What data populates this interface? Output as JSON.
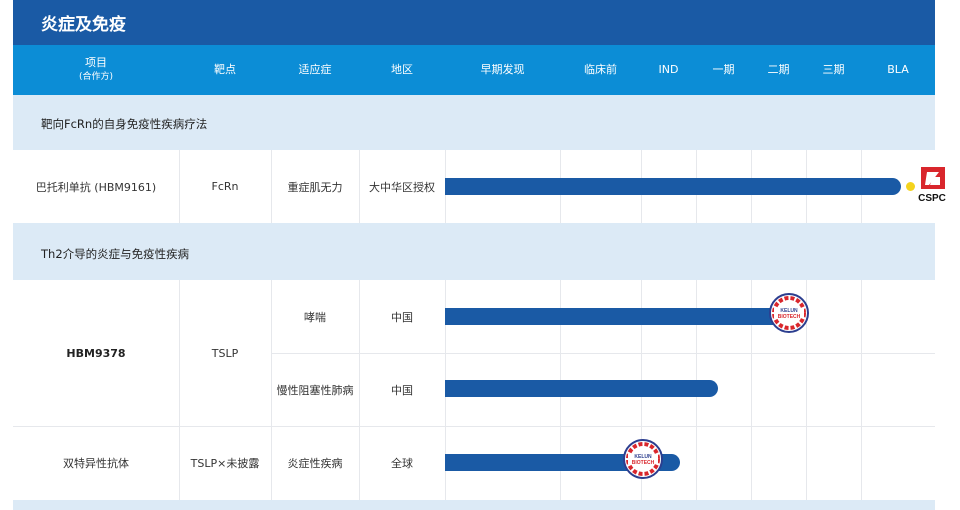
{
  "title": "炎症及免疫",
  "header": {
    "project": "项目",
    "partner": "(合作方)",
    "target": "靶点",
    "indication": "适应症",
    "region": "地区",
    "stages": [
      "早期发现",
      "临床前",
      "IND",
      "一期",
      "二期",
      "三期",
      "BLA"
    ]
  },
  "sections": [
    {
      "label": "靶向FcRn的自身免疫性疾病疗法"
    },
    {
      "label": "Th2介导的炎症与免疫性疾病"
    }
  ],
  "rows": [
    {
      "project": "巴托利单抗 (HBM9161)",
      "target": "FcRn",
      "indication": "重症肌无力",
      "region": "大中华区授权",
      "partner_logo": "cspc-logo",
      "partner_logo_text": "CSPC"
    },
    {
      "project": "HBM9378",
      "target": "TSLP",
      "indication": "哮喘",
      "region": "中国",
      "partner_logo": "hutchmed-logo",
      "partner_logo_text": "KELUN BIOTECH"
    },
    {
      "indication": "慢性阻塞性肺病",
      "region": "中国"
    },
    {
      "project": "双特异性抗体",
      "target": "TSLP×未披露",
      "indication": "炎症性疾病",
      "region": "全球",
      "partner_logo": "hutchmed-logo",
      "partner_logo_text": "KELUN BIOTECH"
    }
  ],
  "chart_data": {
    "type": "bar",
    "orientation": "horizontal",
    "title": "炎症及免疫",
    "stage_axis": [
      "早期发现",
      "临床前",
      "IND",
      "一期",
      "二期",
      "三期",
      "BLA"
    ],
    "categories": [
      "巴托利单抗 (HBM9161) - 重症肌无力",
      "HBM9378 - 哮喘",
      "HBM9378 - 慢性阻塞性肺病",
      "双特异性抗体 - 炎症性疾病"
    ],
    "values": [
      7.0,
      4.7,
      3.4,
      2.7
    ],
    "value_unit": "stages completed (0 = start of 早期发现, 7 = end of BLA)",
    "marker_at_end": [
      true,
      false,
      false,
      false
    ],
    "colors": {
      "bar": "#1a5aa5",
      "marker": "#f4d31d",
      "header": "#0c8dd6",
      "title": "#1a5aa5",
      "section": "#dceaf6"
    }
  }
}
